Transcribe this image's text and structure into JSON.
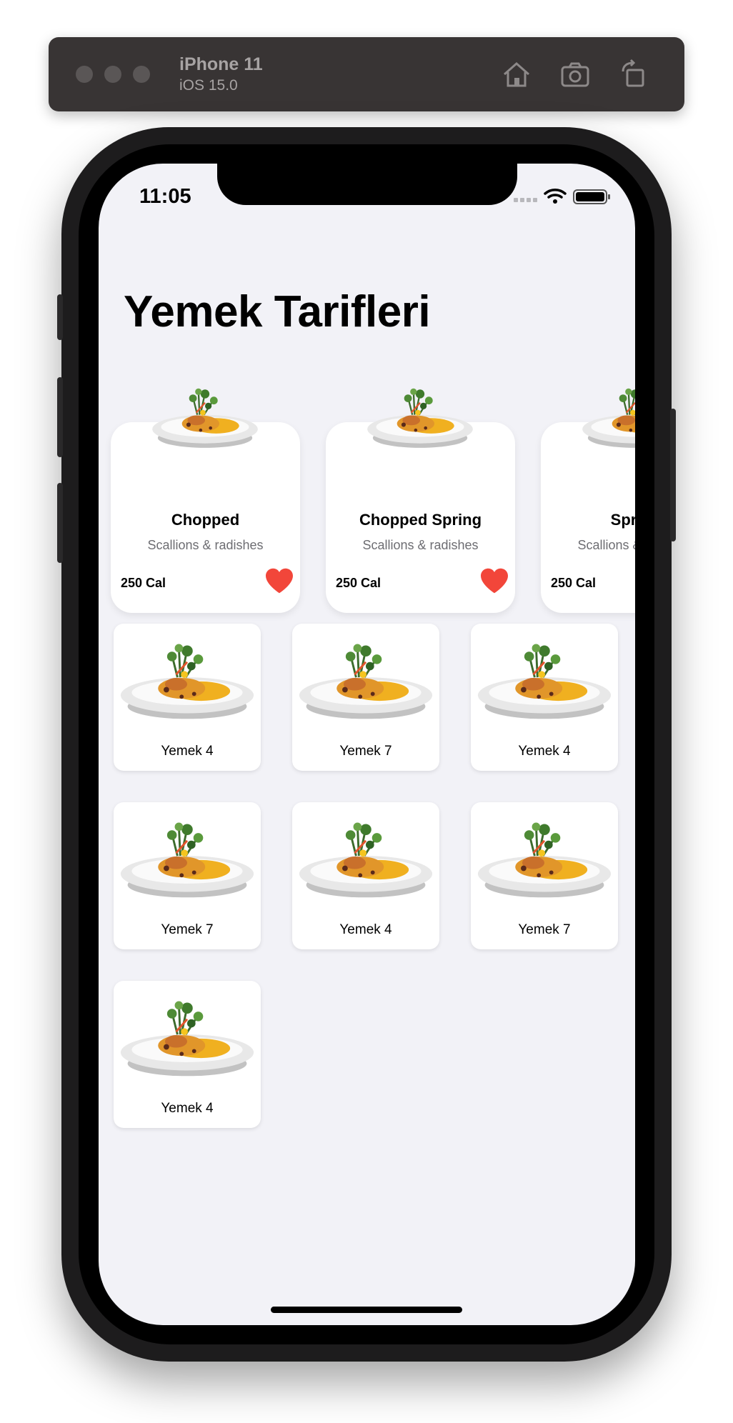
{
  "simulator": {
    "device": "iPhone 11",
    "os": "iOS 15.0",
    "toolbar_icons": [
      "home-icon",
      "screenshot-icon",
      "rotate-icon"
    ]
  },
  "status_bar": {
    "time": "11:05"
  },
  "page": {
    "title": "Yemek Tarifleri"
  },
  "featured": [
    {
      "name": "Chopped",
      "subtitle": "Scallions & radishes",
      "calories": "250 Cal"
    },
    {
      "name": "Chopped Spring",
      "subtitle": "Scallions & radishes",
      "calories": "250 Cal"
    },
    {
      "name": "Spring",
      "subtitle": "Scallions & radishes",
      "calories": "250 Cal"
    }
  ],
  "grid": [
    {
      "label": "Yemek 4"
    },
    {
      "label": "Yemek 7"
    },
    {
      "label": "Yemek 4"
    },
    {
      "label": "Yemek 7"
    },
    {
      "label": "Yemek 4"
    },
    {
      "label": "Yemek 7"
    },
    {
      "label": "Yemek 4"
    }
  ],
  "colors": {
    "heart": "#f2463a",
    "background": "#f2f2f7",
    "sauce": "#f0b020"
  }
}
